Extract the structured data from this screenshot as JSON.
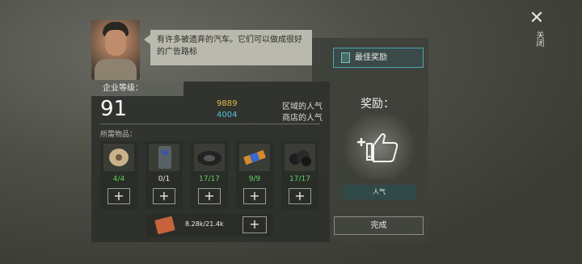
{
  "close": {
    "label": "关闭"
  },
  "npc": {
    "speech": "有许多被遗弃的汽车。它们可以做成很好的广告路标"
  },
  "best_reward": {
    "label": "最佳奖励"
  },
  "company": {
    "level_label": "企业等级：",
    "level": "91",
    "stats": [
      {
        "value": "9889",
        "label": "区域的人气",
        "color": "#e3b84a"
      },
      {
        "value": "4004",
        "label": "商店的人气",
        "color": "#56c3d6"
      }
    ]
  },
  "required": {
    "label": "所需物品：",
    "items": [
      {
        "icon": "wire-spool-icon",
        "count": "4/4"
      },
      {
        "icon": "car-door-icon",
        "count": "0/1"
      },
      {
        "icon": "tire-icon",
        "count": "17/17"
      },
      {
        "icon": "battery-icon",
        "count": "9/9"
      },
      {
        "icon": "coal-icon",
        "count": "17/17"
      }
    ],
    "money": {
      "icon": "cash-icon",
      "amount": "8.28k/21.4k"
    }
  },
  "reward": {
    "title": "奖励：",
    "icon": "thumbs-up-icon",
    "name": "人气"
  },
  "done_button": {
    "label": "完成"
  }
}
